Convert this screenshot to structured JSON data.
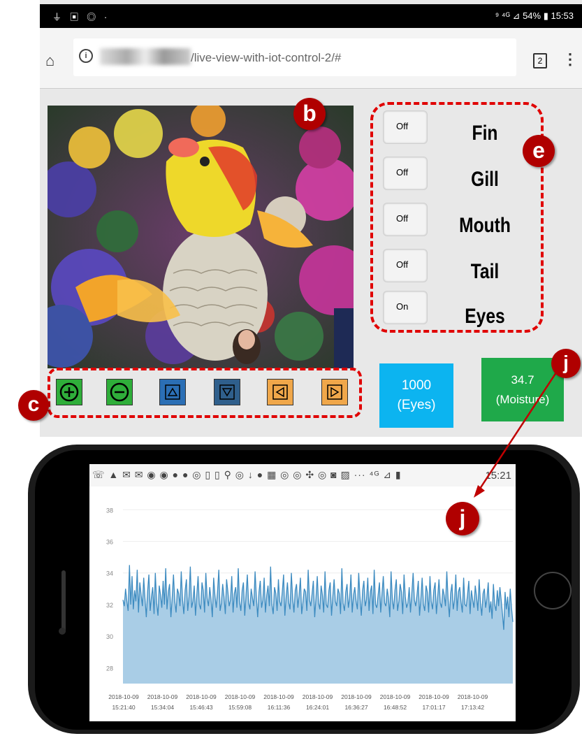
{
  "status_bar": {
    "left_icons": "⏚ ▣ ◎ ·",
    "right": "⁹ ⁴ᴳ ⊿ 54% ▮ 15:53"
  },
  "browser": {
    "url": "/live-view-with-iot-control-2/#",
    "tab_count": "2"
  },
  "markers": {
    "b": "b",
    "c": "c",
    "e": "e",
    "j": "j"
  },
  "toggles": [
    {
      "state": "Off",
      "label": "Fin"
    },
    {
      "state": "Off",
      "label": "Gill"
    },
    {
      "state": "Off",
      "label": "Mouth"
    },
    {
      "state": "Off",
      "label": "Tail"
    },
    {
      "state": "On",
      "label": "Eyes"
    }
  ],
  "controls": {
    "buttons": [
      "zoom-in",
      "zoom-out",
      "up",
      "down",
      "left",
      "right"
    ]
  },
  "tiles": {
    "eyes": {
      "value": "1000",
      "label": "(Eyes)",
      "color": "#0cb4f0"
    },
    "moisture": {
      "value": "34.7",
      "label": "(Moisture)",
      "color": "#1fa94a"
    }
  },
  "phone": {
    "time": "15:21",
    "status_icons": "☏ ▲ ✉ ✉ ◉ ◉ ● ● ◎ ▯ ▯ ⚲ ◎ ↓ ● ▦ ◎ ◎ ✣ ◎ ◙ ▨ ··· ⁴ᴳ ⊿ ▮"
  },
  "chart_data": {
    "type": "area",
    "ylim": [
      27,
      38.5
    ],
    "y_ticks": [
      "38",
      "36",
      "34",
      "32",
      "30",
      "28"
    ],
    "x_ticks": [
      [
        "2018-10-09",
        "15:21:40"
      ],
      [
        "2018-10-09",
        "15:34:04"
      ],
      [
        "2018-10-09",
        "15:46:43"
      ],
      [
        "2018-10-09",
        "15:59:08"
      ],
      [
        "2018-10-09",
        "16:11:36"
      ],
      [
        "2018-10-09",
        "16:24:01"
      ],
      [
        "2018-10-09",
        "16:36:27"
      ],
      [
        "2018-10-09",
        "16:48:52"
      ],
      [
        "2018-10-09",
        "17:01:17"
      ],
      [
        "2018-10-09",
        "17:13:42"
      ]
    ],
    "series": [
      {
        "values": [
          32.3,
          31.9,
          33.0,
          32.2,
          31.6,
          34.5,
          32.0,
          33.8,
          31.7,
          32.9,
          32.2,
          34.2,
          31.5,
          33.4,
          32.6,
          31.9,
          33.7,
          32.4,
          31.2,
          32.8,
          33.9,
          31.6,
          32.5,
          33.1,
          31.4,
          34.0,
          32.1,
          31.3,
          33.2,
          32.6,
          31.8,
          33.5,
          32.0,
          34.3,
          31.7,
          32.8,
          33.3,
          31.2,
          32.4,
          33.9,
          32.2,
          31.5,
          33.0,
          32.7,
          31.9,
          34.1,
          32.3,
          31.4,
          32.9,
          33.6,
          31.6,
          32.5,
          34.4,
          31.8,
          32.2,
          33.2,
          31.3,
          32.6,
          33.8,
          32.0,
          31.7,
          33.4,
          32.9,
          31.5,
          34.0,
          32.4,
          31.9,
          33.1,
          32.3,
          31.2,
          33.7,
          32.6,
          31.8,
          32.8,
          34.2,
          31.6,
          32.1,
          33.3,
          32.5,
          31.4,
          33.6,
          32.8,
          31.9,
          32.3,
          33.8,
          31.5,
          32.7,
          33.1,
          31.8,
          34.3,
          32.2,
          31.6,
          32.9,
          33.4,
          31.3,
          32.6,
          33.9,
          32.1,
          31.7,
          33.0,
          32.4,
          31.9,
          34.1,
          32.5,
          31.2,
          32.8,
          33.5,
          31.8,
          32.3,
          33.7,
          31.5,
          32.6,
          33.2,
          31.9,
          34.4,
          32.0,
          31.4,
          33.1,
          32.7,
          31.6,
          33.6,
          32.2,
          31.9,
          32.8,
          33.9,
          31.3,
          32.5,
          33.4,
          32.1,
          31.7,
          34.0,
          32.4,
          31.5,
          32.9,
          33.3,
          31.8,
          32.6,
          33.7,
          31.4,
          32.2,
          33.0,
          32.8,
          31.6,
          34.2,
          32.3,
          31.9,
          32.7,
          33.5,
          31.2,
          32.4,
          33.8,
          32.1,
          31.7,
          33.2,
          32.6,
          31.5,
          34.1,
          32.0,
          31.8,
          32.9,
          33.4,
          31.3,
          32.5,
          33.6,
          32.2,
          31.9,
          33.0,
          32.7,
          31.4,
          34.3,
          32.1,
          31.6,
          32.8,
          33.3,
          31.8,
          32.4,
          33.9,
          31.5,
          32.6,
          33.1,
          32.2,
          31.7,
          34.0,
          32.5,
          31.3,
          32.9,
          33.5,
          31.9,
          32.3,
          33.7,
          31.6,
          32.8,
          33.2,
          31.4,
          34.2,
          32.0,
          31.8,
          32.6,
          33.4,
          31.5,
          32.7,
          33.8,
          32.1,
          31.9,
          33.0,
          32.4,
          31.2,
          34.1,
          32.3,
          31.7,
          32.9,
          33.6,
          31.6,
          32.2,
          33.3,
          32.8,
          31.4,
          33.9,
          32.5,
          31.8,
          32.1,
          33.1,
          31.5,
          32.7,
          34.0,
          32.3,
          31.9,
          32.6,
          33.5,
          31.3,
          32.4,
          33.7,
          32.0,
          31.6,
          33.2,
          32.8,
          31.5,
          33.8,
          32.2,
          31.7,
          32.9,
          33.4,
          31.4,
          32.5,
          33.6,
          32.1,
          31.8,
          33.0,
          32.6,
          31.9,
          34.1,
          32.4,
          31.2,
          32.7,
          33.3,
          31.7,
          32.3,
          33.9,
          31.6,
          32.8,
          33.1,
          32.2,
          31.5,
          33.7,
          32.0,
          31.9,
          32.6,
          33.5,
          31.4,
          32.9,
          32.3,
          31.8,
          33.2,
          32.5,
          31.6,
          33.6,
          32.1,
          31.3,
          32.7,
          33.0,
          31.8,
          32.4,
          33.4,
          31.5,
          32.2,
          31.1,
          33.3,
          32.0,
          31.6,
          32.9,
          31.9,
          33.1,
          32.3,
          31.4,
          30.4,
          32.8,
          31.7,
          32.5,
          31.2,
          33.0,
          31.8,
          30.9
        ]
      }
    ]
  }
}
